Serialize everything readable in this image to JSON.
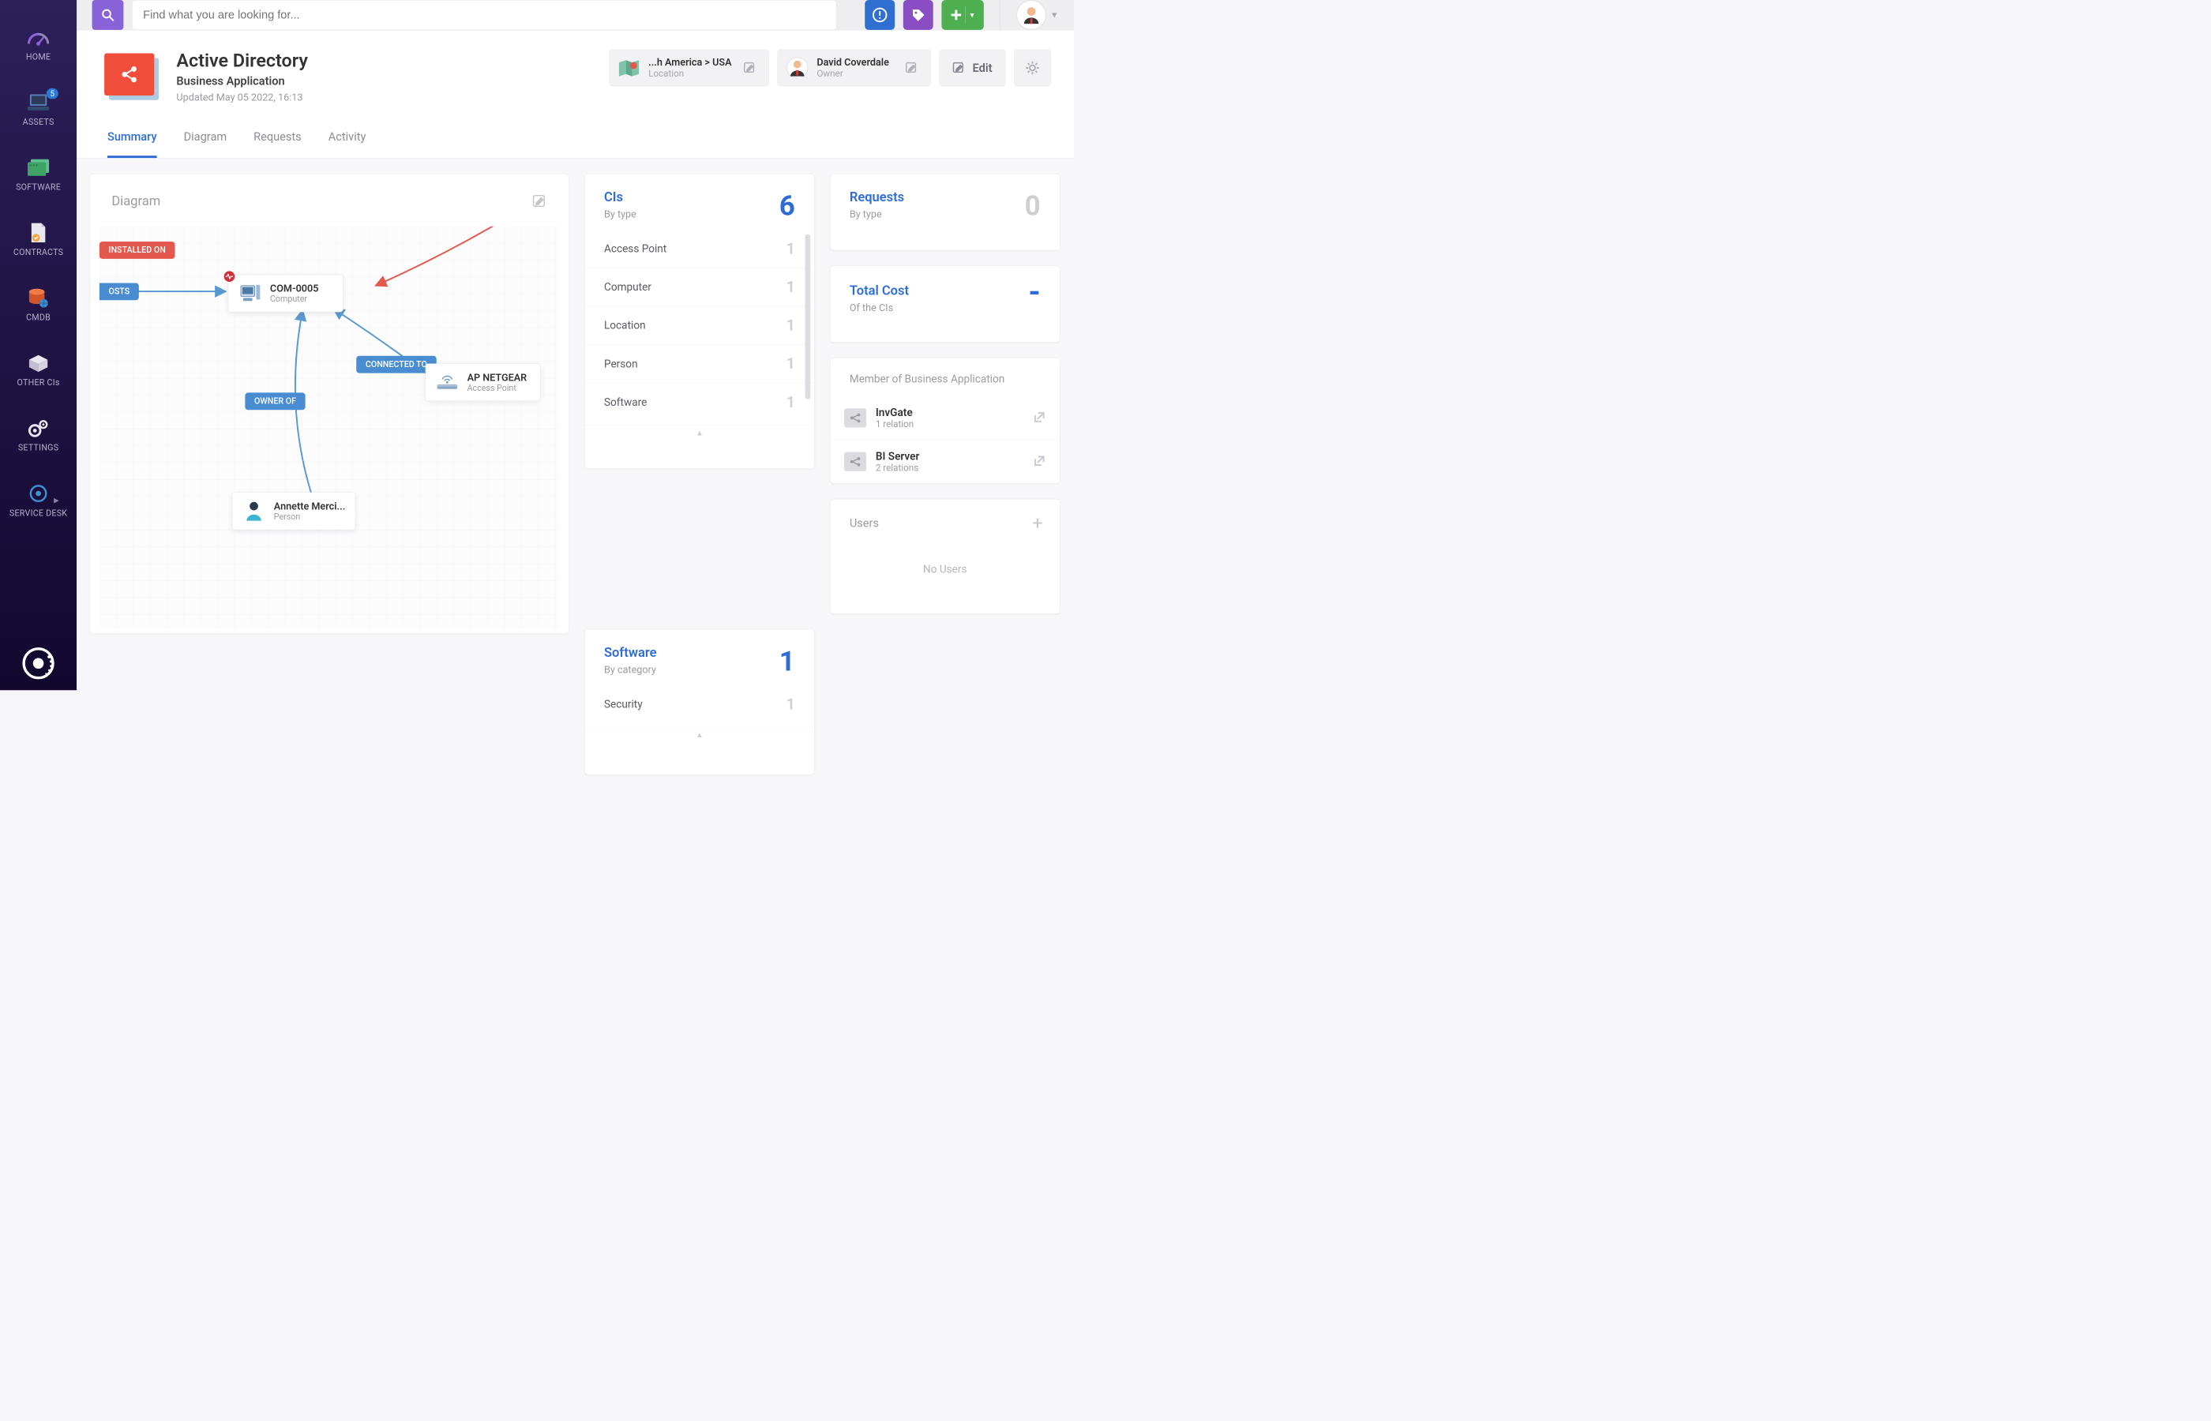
{
  "search": {
    "placeholder": "Find what you are looking for..."
  },
  "sidebar": {
    "items": [
      {
        "label": "HOME"
      },
      {
        "label": "ASSETS",
        "badge": "5"
      },
      {
        "label": "SOFTWARE"
      },
      {
        "label": "CONTRACTS"
      },
      {
        "label": "CMDB"
      },
      {
        "label": "OTHER CIs"
      },
      {
        "label": "SETTINGS"
      },
      {
        "label": "SERVICE DESK"
      }
    ]
  },
  "header": {
    "title": "Active Directory",
    "subtitle": "Business Application",
    "updated": "Updated May 05 2022, 16:13",
    "location": {
      "value": "...h America > USA",
      "label": "Location"
    },
    "owner": {
      "value": "David Coverdale",
      "label": "Owner"
    },
    "editLabel": "Edit"
  },
  "tabs": [
    "Summary",
    "Diagram",
    "Requests",
    "Activity"
  ],
  "diagram": {
    "title": "Diagram",
    "nodes": {
      "com": {
        "title": "COM-0005",
        "sub": "Computer"
      },
      "ap": {
        "title": "AP NETGEAR",
        "sub": "Access Point"
      },
      "person": {
        "title": "Annette Merci...",
        "sub": "Person"
      }
    },
    "edges": {
      "hosts": "OSTS",
      "installed": "INSTALLED ON",
      "connected": "CONNECTED TO",
      "owner": "OWNER OF"
    }
  },
  "cis": {
    "title": "CIs",
    "sub": "By type",
    "total": "6",
    "rows": [
      {
        "label": "Access Point",
        "count": "1"
      },
      {
        "label": "Computer",
        "count": "1"
      },
      {
        "label": "Location",
        "count": "1"
      },
      {
        "label": "Person",
        "count": "1"
      },
      {
        "label": "Software",
        "count": "1"
      }
    ]
  },
  "software": {
    "title": "Software",
    "sub": "By category",
    "total": "1",
    "rows": [
      {
        "label": "Security",
        "count": "1"
      }
    ]
  },
  "requests": {
    "title": "Requests",
    "sub": "By type",
    "total": "0"
  },
  "totalCost": {
    "title": "Total Cost",
    "sub": "Of the CIs",
    "value": "-"
  },
  "member": {
    "title": "Member of Business Application",
    "rows": [
      {
        "title": "InvGate",
        "sub": "1 relation"
      },
      {
        "title": "BI Server",
        "sub": "2 relations"
      }
    ]
  },
  "users": {
    "title": "Users",
    "empty": "No Users"
  }
}
